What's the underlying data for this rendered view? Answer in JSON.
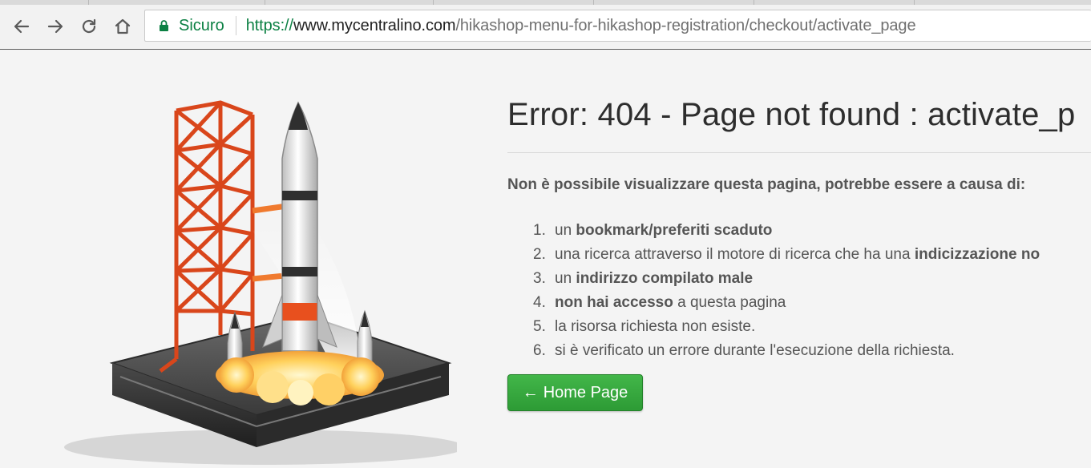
{
  "browser": {
    "secure_label": "Sicuro",
    "url": {
      "scheme": "https://",
      "host": "www.mycentralino.com",
      "path": "/hikashop-menu-for-hikashop-registration/checkout/activate_page"
    },
    "icons": {
      "back": "arrow-left-icon",
      "forward": "arrow-right-icon",
      "reload": "reload-icon",
      "home": "home-icon",
      "lock": "lock-icon"
    }
  },
  "page": {
    "title": "Error: 404 - Page not found : activate_p",
    "lead": "Non è possibile visualizzare questa pagina, potrebbe essere a causa di:",
    "reasons": [
      {
        "num": "1.",
        "pre": "un ",
        "bold": "bookmark/preferiti scaduto",
        "post": ""
      },
      {
        "num": "2.",
        "pre": "una ricerca attraverso il motore di ricerca che ha una ",
        "bold": "indicizzazione no",
        "post": ""
      },
      {
        "num": "3.",
        "pre": "un ",
        "bold": "indirizzo compilato male",
        "post": ""
      },
      {
        "num": "4.",
        "pre": "",
        "bold": "non hai accesso",
        "post": " a questa pagina"
      },
      {
        "num": "5.",
        "pre": "la risorsa richiesta non esiste.",
        "bold": "",
        "post": ""
      },
      {
        "num": "6.",
        "pre": "si è verificato un errore durante l'esecuzione della richiesta.",
        "bold": "",
        "post": ""
      }
    ],
    "home_button": {
      "arrow": "←",
      "label": "Home Page"
    }
  },
  "colors": {
    "secure_green": "#0b8043",
    "button_green": "#2d9b35",
    "rocket_orange": "#e8501e"
  }
}
